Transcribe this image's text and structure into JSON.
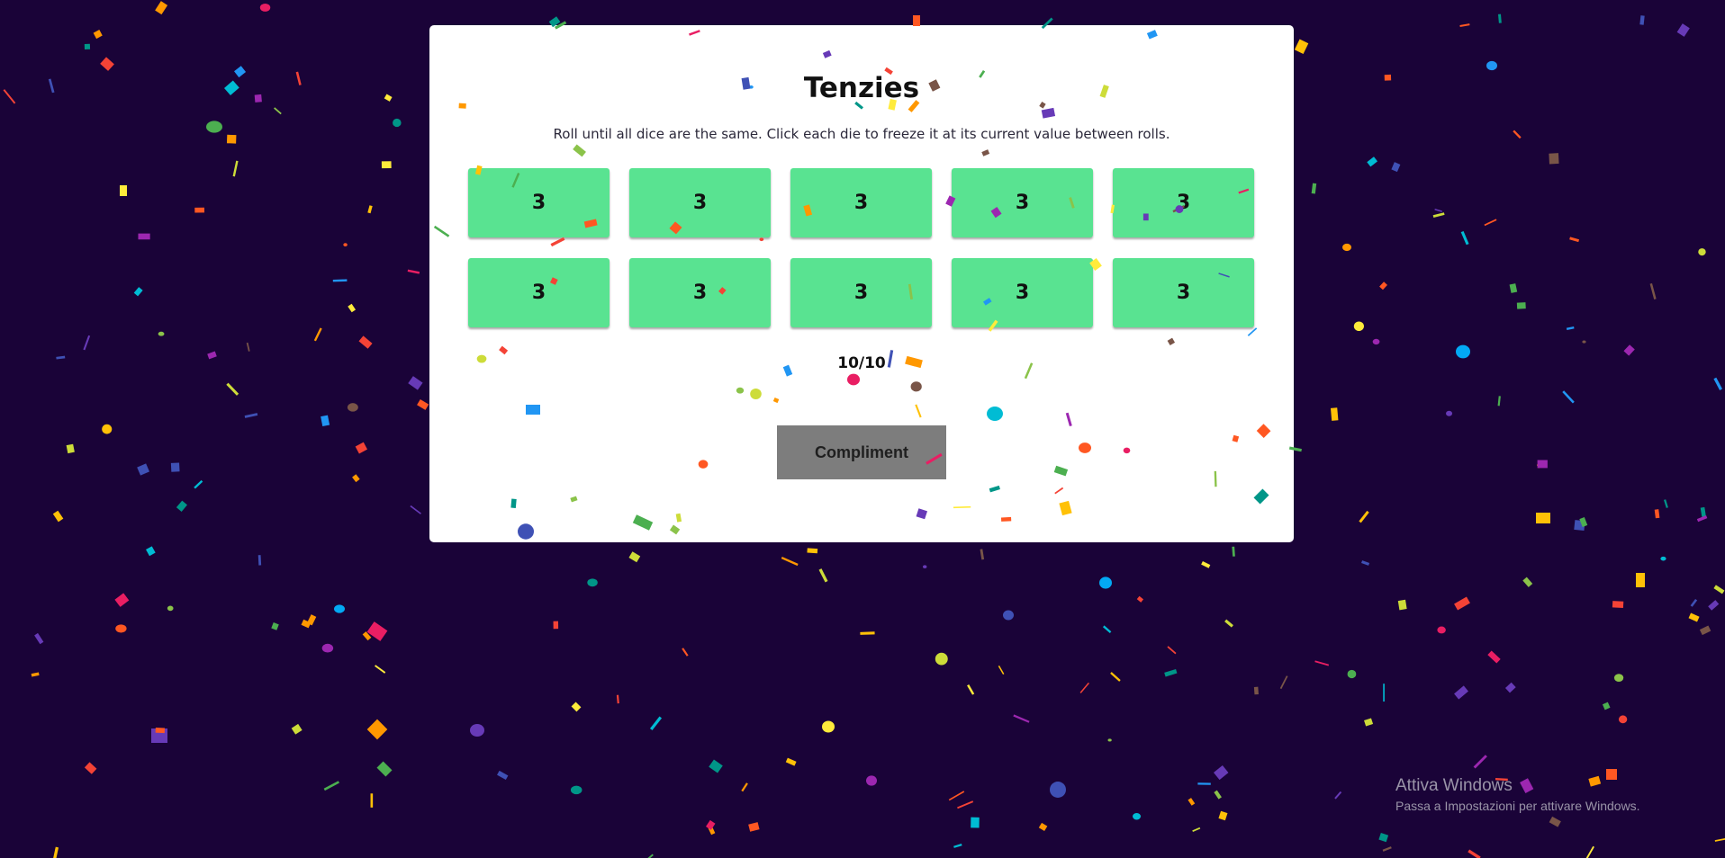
{
  "game": {
    "title": "Tenzies",
    "instructions": "Roll until all dice are the same. Click each die to freeze it at its current value between rolls.",
    "dice": [
      "3",
      "3",
      "3",
      "3",
      "3",
      "3",
      "3",
      "3",
      "3",
      "3"
    ],
    "counter": "10/10",
    "button_label": "Compliment"
  },
  "windows_activation": {
    "title": "Attiva Windows",
    "subtitle": "Passa a Impostazioni per attivare Windows."
  },
  "colors": {
    "background": "#1a0338",
    "card": "#ffffff",
    "die": "#59e391",
    "button": "#7d7d7d"
  }
}
